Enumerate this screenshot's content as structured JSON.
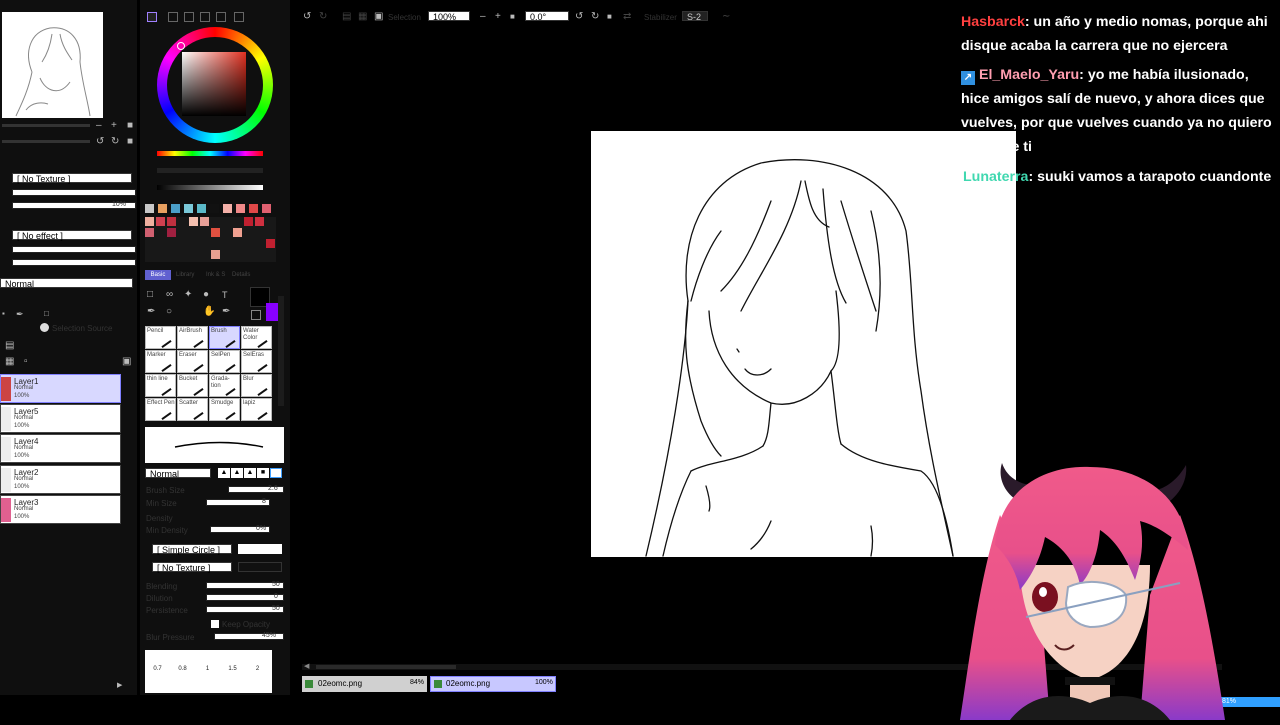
{
  "navigator": {
    "zoom": "",
    "angle": ""
  },
  "left": {
    "texture_select": "[ No Texture ]",
    "effect_select": "[ No effect ]",
    "blend_mode": "Normal",
    "texture_value": "10%",
    "selection_source": "Selection Source",
    "layers": [
      {
        "name": "Layer1",
        "mode": "Normal",
        "opacity": "100%"
      },
      {
        "name": "Layer5",
        "mode": "Normal",
        "opacity": "100%"
      },
      {
        "name": "Layer4",
        "mode": "Normal",
        "opacity": "100%"
      },
      {
        "name": "Layer2",
        "mode": "Normal",
        "opacity": "100%"
      },
      {
        "name": "Layer3",
        "mode": "Normal",
        "opacity": "100%"
      }
    ]
  },
  "colors": {
    "swatches": [
      "#c8c8c8",
      "#e8a060",
      "#4a9ec8",
      "#7ac8d8",
      "#5ab8c8",
      "#111111",
      "#f4b0a8",
      "#f08888",
      "#e04848",
      "#e06070"
    ],
    "grid": [
      "#f0b0a0",
      "#d04050",
      "#c03040",
      "#f4c0b0",
      "#e8a098"
    ],
    "accent": "#8800ff"
  },
  "tool_tabs": [
    "Basic",
    "Library",
    "Ink & S",
    "Details"
  ],
  "tools": [
    {
      "label": "Pencil"
    },
    {
      "label": "AirBrush"
    },
    {
      "label": "Brush"
    },
    {
      "label": "Water Color"
    },
    {
      "label": "Marker"
    },
    {
      "label": "Eraser"
    },
    {
      "label": "SelPen"
    },
    {
      "label": "SelEras"
    },
    {
      "label": "thin line"
    },
    {
      "label": "Bucket"
    },
    {
      "label": "Grada-tion"
    },
    {
      "label": "Blur"
    },
    {
      "label": "Effect Pen"
    },
    {
      "label": "Scatter"
    },
    {
      "label": "Smudge"
    },
    {
      "label": "lapiz"
    }
  ],
  "brush": {
    "mode": "Normal",
    "brush_size_label": "Brush Size",
    "brush_size": "2.6",
    "min_size_label": "Min Size",
    "min_size": "8",
    "density_label": "Density",
    "min_density_label": "Min Density",
    "min_density": "0%",
    "shape": "[ Simple Circle ]",
    "texture": "[ No Texture ]",
    "blending_label": "Blending",
    "blending": "50",
    "dilution_label": "Dilution",
    "dilution": "0",
    "persistence_label": "Persistence",
    "persistence": "50",
    "keep_opacity_label": "Keep Opacity",
    "blur_pressure_label": "Blur Pressure",
    "blur_pressure": "45%",
    "sizes_row1": [
      "0.7",
      "0.8",
      "1",
      "1.5",
      "2"
    ]
  },
  "toolbar": {
    "selection_label": "Selection",
    "zoom": "100%",
    "angle": "0.0°",
    "stabilizer_label": "Stabilizer",
    "stabilizer": "S-2"
  },
  "tabs": [
    {
      "name": "02eomc.png",
      "zoom": "84%"
    },
    {
      "name": "02eomc.png",
      "zoom": "100%"
    }
  ],
  "status": {
    "memory": "81%"
  },
  "chat": [
    {
      "user": "Hasbarck",
      "user_color": "#ff4040",
      "badge": false,
      "message": ": un año y medio nomas, porque ahi disque acaba la carrera que no ejercera"
    },
    {
      "user": "El_Maelo_Yaru",
      "user_color": "#ff9eb0",
      "badge": true,
      "message": ": yo me había ilusionado, hice amigos salí de nuevo, y ahora dices que vuelves, por que vuelves cuando ya no quiero saber de ti"
    },
    {
      "user": "Lunaterra",
      "user_color": "#40d8b0",
      "badge": false,
      "message": ": suuki vamos a tarapoto cuandonte gradues"
    }
  ]
}
